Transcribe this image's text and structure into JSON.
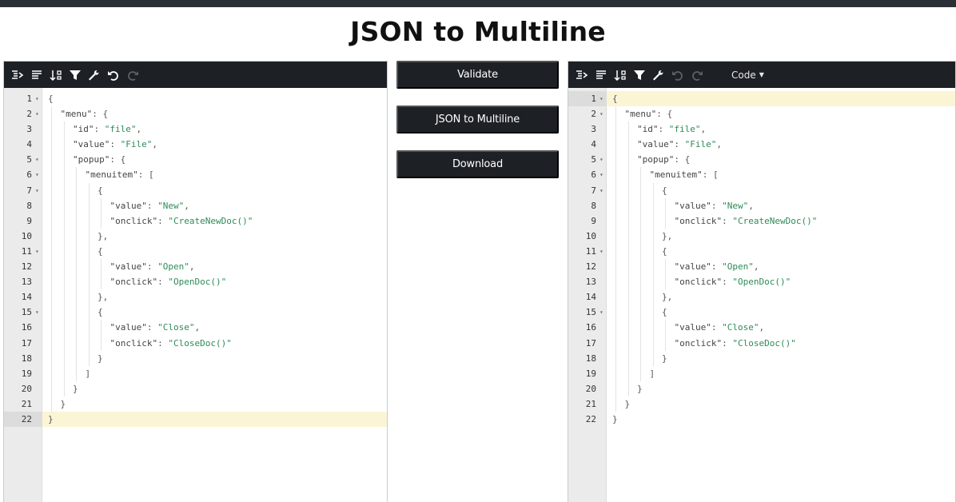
{
  "page": {
    "title": "JSON to Multiline"
  },
  "actions": {
    "validate": "Validate",
    "convert": "JSON to Multiline",
    "download": "Download"
  },
  "left_editor": {
    "toolbar_icons": [
      "format-icon",
      "compact-icon",
      "sort-icon",
      "filter-icon",
      "repair-icon",
      "undo-icon",
      "redo-icon"
    ],
    "active_line": 22
  },
  "right_editor": {
    "toolbar_icons": [
      "format-icon",
      "compact-icon",
      "sort-icon",
      "filter-icon",
      "repair-icon",
      "undo-icon",
      "redo-icon"
    ],
    "mode_label": "Code",
    "active_line": 1
  },
  "code_lines": [
    {
      "n": "1",
      "fold": true,
      "depth": 0,
      "t": "{"
    },
    {
      "n": "2",
      "fold": true,
      "depth": 1,
      "t": "\"menu\": {"
    },
    {
      "n": "3",
      "fold": false,
      "depth": 2,
      "t": "\"id\": \"file\","
    },
    {
      "n": "4",
      "fold": false,
      "depth": 2,
      "t": "\"value\": \"File\","
    },
    {
      "n": "5",
      "fold": true,
      "depth": 2,
      "t": "\"popup\": {"
    },
    {
      "n": "6",
      "fold": true,
      "depth": 3,
      "t": "\"menuitem\": ["
    },
    {
      "n": "7",
      "fold": true,
      "depth": 4,
      "t": "{"
    },
    {
      "n": "8",
      "fold": false,
      "depth": 5,
      "t": "\"value\": \"New\","
    },
    {
      "n": "9",
      "fold": false,
      "depth": 5,
      "t": "\"onclick\": \"CreateNewDoc()\""
    },
    {
      "n": "10",
      "fold": false,
      "depth": 4,
      "t": "},"
    },
    {
      "n": "11",
      "fold": true,
      "depth": 4,
      "t": "{"
    },
    {
      "n": "12",
      "fold": false,
      "depth": 5,
      "t": "\"value\": \"Open\","
    },
    {
      "n": "13",
      "fold": false,
      "depth": 5,
      "t": "\"onclick\": \"OpenDoc()\""
    },
    {
      "n": "14",
      "fold": false,
      "depth": 4,
      "t": "},"
    },
    {
      "n": "15",
      "fold": true,
      "depth": 4,
      "t": "{"
    },
    {
      "n": "16",
      "fold": false,
      "depth": 5,
      "t": "\"value\": \"Close\","
    },
    {
      "n": "17",
      "fold": false,
      "depth": 5,
      "t": "\"onclick\": \"CloseDoc()\""
    },
    {
      "n": "18",
      "fold": false,
      "depth": 4,
      "t": "}"
    },
    {
      "n": "19",
      "fold": false,
      "depth": 3,
      "t": "]"
    },
    {
      "n": "20",
      "fold": false,
      "depth": 2,
      "t": "}"
    },
    {
      "n": "21",
      "fold": false,
      "depth": 1,
      "t": "}"
    },
    {
      "n": "22",
      "fold": false,
      "depth": 0,
      "t": "}"
    }
  ]
}
